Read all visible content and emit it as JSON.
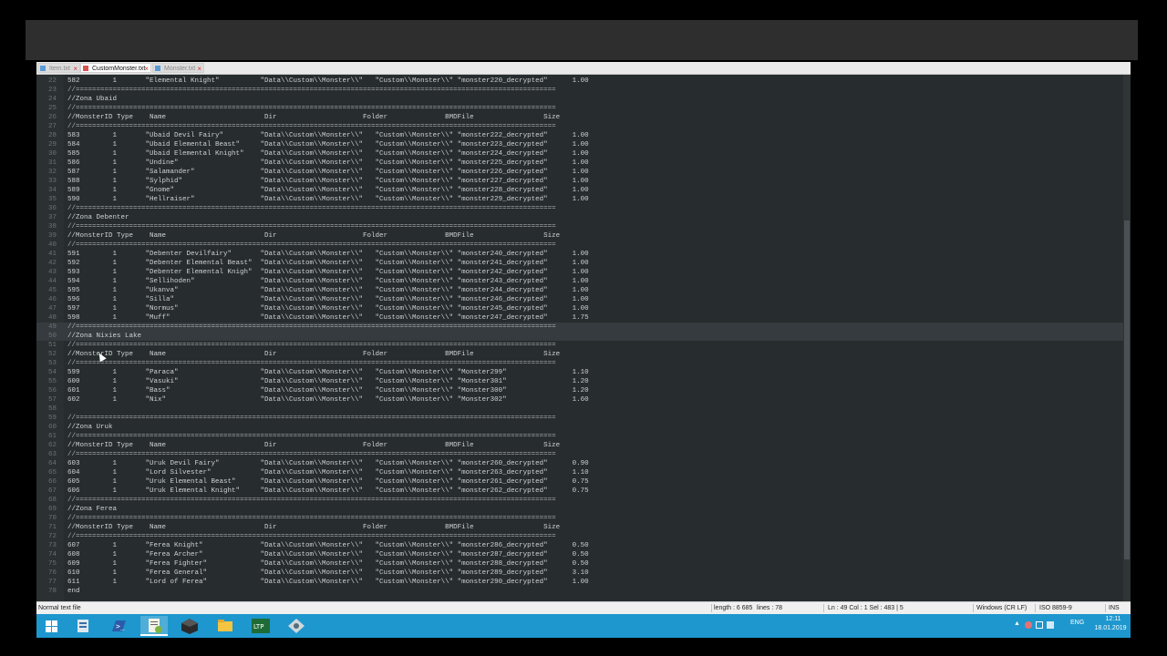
{
  "tabs": [
    {
      "label": "Item.txt",
      "active": false
    },
    {
      "label": "CustomMonster.txt",
      "active": true
    },
    {
      "label": "Monster.txt",
      "active": false
    }
  ],
  "lines": [
    {
      "n": "22",
      "t": "582        1       \"Elemental Knight\"          \"Data\\\\Custom\\\\Monster\\\\\"   \"Custom\\\\Monster\\\\\" \"monster220_decrypted\"      1.00"
    },
    {
      "n": "23",
      "sep": true
    },
    {
      "n": "24",
      "t": "//Zona Ubaid"
    },
    {
      "n": "25",
      "sep": true
    },
    {
      "n": "26",
      "t": "//MonsterID Type    Name                        Dir                     Folder              BMDFile                 Size"
    },
    {
      "n": "27",
      "sep": true
    },
    {
      "n": "28",
      "t": "583        1       \"Ubaid Devil Fairy\"         \"Data\\\\Custom\\\\Monster\\\\\"   \"Custom\\\\Monster\\\\\" \"monster222_decrypted\"      1.00"
    },
    {
      "n": "29",
      "t": "584        1       \"Ubaid Elemental Beast\"     \"Data\\\\Custom\\\\Monster\\\\\"   \"Custom\\\\Monster\\\\\" \"monster223_decrypted\"      1.00"
    },
    {
      "n": "30",
      "t": "585        1       \"Ubaid Elemental Knight\"    \"Data\\\\Custom\\\\Monster\\\\\"   \"Custom\\\\Monster\\\\\" \"monster224_decrypted\"      1.00"
    },
    {
      "n": "31",
      "t": "586        1       \"Undine\"                    \"Data\\\\Custom\\\\Monster\\\\\"   \"Custom\\\\Monster\\\\\" \"monster225_decrypted\"      1.00"
    },
    {
      "n": "32",
      "t": "587        1       \"Salamander\"                \"Data\\\\Custom\\\\Monster\\\\\"   \"Custom\\\\Monster\\\\\" \"monster226_decrypted\"      1.00"
    },
    {
      "n": "33",
      "t": "588        1       \"Sylphid\"                   \"Data\\\\Custom\\\\Monster\\\\\"   \"Custom\\\\Monster\\\\\" \"monster227_decrypted\"      1.00"
    },
    {
      "n": "34",
      "t": "589        1       \"Gnome\"                     \"Data\\\\Custom\\\\Monster\\\\\"   \"Custom\\\\Monster\\\\\" \"monster228_decrypted\"      1.00"
    },
    {
      "n": "35",
      "t": "590        1       \"Hellraiser\"                \"Data\\\\Custom\\\\Monster\\\\\"   \"Custom\\\\Monster\\\\\" \"monster229_decrypted\"      1.00"
    },
    {
      "n": "36",
      "sep": true
    },
    {
      "n": "37",
      "t": "//Zona Debenter"
    },
    {
      "n": "38",
      "sep": true
    },
    {
      "n": "39",
      "t": "//MonsterID Type    Name                        Dir                     Folder              BMDFile                 Size"
    },
    {
      "n": "40",
      "sep": true
    },
    {
      "n": "41",
      "t": "591        1       \"Debenter Devilfairy\"       \"Data\\\\Custom\\\\Monster\\\\\"   \"Custom\\\\Monster\\\\\" \"monster240_decrypted\"      1.00"
    },
    {
      "n": "42",
      "t": "592        1       \"Debenter Elemental Beast\"  \"Data\\\\Custom\\\\Monster\\\\\"   \"Custom\\\\Monster\\\\\" \"monster241_decrypted\"      1.00"
    },
    {
      "n": "43",
      "t": "593        1       \"Debenter Elemental Knigh\"  \"Data\\\\Custom\\\\Monster\\\\\"   \"Custom\\\\Monster\\\\\" \"monster242_decrypted\"      1.00"
    },
    {
      "n": "44",
      "t": "594        1       \"Sellihoden\"                \"Data\\\\Custom\\\\Monster\\\\\"   \"Custom\\\\Monster\\\\\" \"monster243_decrypted\"      1.00"
    },
    {
      "n": "45",
      "t": "595        1       \"Ukanva\"                    \"Data\\\\Custom\\\\Monster\\\\\"   \"Custom\\\\Monster\\\\\" \"monster244_decrypted\"      1.00"
    },
    {
      "n": "46",
      "t": "596        1       \"Silla\"                     \"Data\\\\Custom\\\\Monster\\\\\"   \"Custom\\\\Monster\\\\\" \"monster246_decrypted\"      1.00"
    },
    {
      "n": "47",
      "t": "597        1       \"Normus\"                    \"Data\\\\Custom\\\\Monster\\\\\"   \"Custom\\\\Monster\\\\\" \"monster245_decrypted\"      1.00"
    },
    {
      "n": "48",
      "t": "598        1       \"Muff\"                      \"Data\\\\Custom\\\\Monster\\\\\"   \"Custom\\\\Monster\\\\\" \"monster247_decrypted\"      1.75"
    },
    {
      "n": "49",
      "sep": true,
      "current": true
    },
    {
      "n": "50",
      "t": "//Zona Nixies Lake",
      "current": true
    },
    {
      "n": "51",
      "sep": true
    },
    {
      "n": "52",
      "t": "//MonsterID Type    Name                        Dir                     Folder              BMDFile                 Size"
    },
    {
      "n": "53",
      "sep": true
    },
    {
      "n": "54",
      "t": "599        1       \"Paraca\"                    \"Data\\\\Custom\\\\Monster\\\\\"   \"Custom\\\\Monster\\\\\" \"Monster299\"                1.10"
    },
    {
      "n": "55",
      "t": "600        1       \"Vasuki\"                    \"Data\\\\Custom\\\\Monster\\\\\"   \"Custom\\\\Monster\\\\\" \"Monster301\"                1.20"
    },
    {
      "n": "56",
      "t": "601        1       \"Bass\"                      \"Data\\\\Custom\\\\Monster\\\\\"   \"Custom\\\\Monster\\\\\" \"Monster300\"                1.20"
    },
    {
      "n": "57",
      "t": "602        1       \"Nix\"                       \"Data\\\\Custom\\\\Monster\\\\\"   \"Custom\\\\Monster\\\\\" \"Monster302\"                1.60"
    },
    {
      "n": "58",
      "t": ""
    },
    {
      "n": "59",
      "sep": true
    },
    {
      "n": "60",
      "t": "//Zona Uruk"
    },
    {
      "n": "61",
      "sep": true
    },
    {
      "n": "62",
      "t": "//MonsterID Type    Name                        Dir                     Folder              BMDFile                 Size"
    },
    {
      "n": "63",
      "sep": true
    },
    {
      "n": "64",
      "t": "603        1       \"Uruk Devil Fairy\"          \"Data\\\\Custom\\\\Monster\\\\\"   \"Custom\\\\Monster\\\\\" \"monster260_decrypted\"      0.90"
    },
    {
      "n": "65",
      "t": "604        1       \"Lord Silvester\"            \"Data\\\\Custom\\\\Monster\\\\\"   \"Custom\\\\Monster\\\\\" \"monster263_decrypted\"      1.10"
    },
    {
      "n": "66",
      "t": "605        1       \"Uruk Elemental Beast\"      \"Data\\\\Custom\\\\Monster\\\\\"   \"Custom\\\\Monster\\\\\" \"monster261_decrypted\"      0.75"
    },
    {
      "n": "67",
      "t": "606        1       \"Uruk Elemental Knight\"     \"Data\\\\Custom\\\\Monster\\\\\"   \"Custom\\\\Monster\\\\\" \"monster262_decrypted\"      0.75"
    },
    {
      "n": "68",
      "sep": true
    },
    {
      "n": "69",
      "t": "//Zona Ferea"
    },
    {
      "n": "70",
      "sep": true
    },
    {
      "n": "71",
      "t": "//MonsterID Type    Name                        Dir                     Folder              BMDFile                 Size"
    },
    {
      "n": "72",
      "sep": true
    },
    {
      "n": "73",
      "t": "607        1       \"Ferea Knight\"              \"Data\\\\Custom\\\\Monster\\\\\"   \"Custom\\\\Monster\\\\\" \"monster286_decrypted\"      0.50"
    },
    {
      "n": "74",
      "t": "608        1       \"Ferea Archer\"              \"Data\\\\Custom\\\\Monster\\\\\"   \"Custom\\\\Monster\\\\\" \"monster287_decrypted\"      0.50"
    },
    {
      "n": "75",
      "t": "609        1       \"Ferea Fighter\"             \"Data\\\\Custom\\\\Monster\\\\\"   \"Custom\\\\Monster\\\\\" \"monster288_decrypted\"      0.50"
    },
    {
      "n": "76",
      "t": "610        1       \"Ferea General\"             \"Data\\\\Custom\\\\Monster\\\\\"   \"Custom\\\\Monster\\\\\" \"monster289_decrypted\"      3.10"
    },
    {
      "n": "77",
      "t": "611        1       \"Lord of Ferea\"             \"Data\\\\Custom\\\\Monster\\\\\"   \"Custom\\\\Monster\\\\\" \"monster290_decrypted\"      1.00"
    },
    {
      "n": "78",
      "t": "end"
    }
  ],
  "separator_text": "//=====================================================================================================================",
  "status": {
    "file_type": "Normal text file",
    "length": "length : 6 685",
    "lines": "lines : 78",
    "position": "Ln : 49    Col : 1    Sel : 483 | 5",
    "eol": "Windows (CR LF)",
    "encoding": "ISO 8859-9",
    "mode": "INS"
  },
  "taskbar": {
    "apps": [
      "windows-start",
      "file-manager",
      "powershell",
      "notepad-plus-plus",
      "3d-box",
      "folder",
      "ltp-app",
      "network-tool"
    ],
    "language": "ENG",
    "time": "12:11",
    "date": "18.01.2019"
  },
  "colors": {
    "editor_bg": "#272c2e",
    "text": "#cfd2d3",
    "taskbar": "#1e97ce"
  }
}
